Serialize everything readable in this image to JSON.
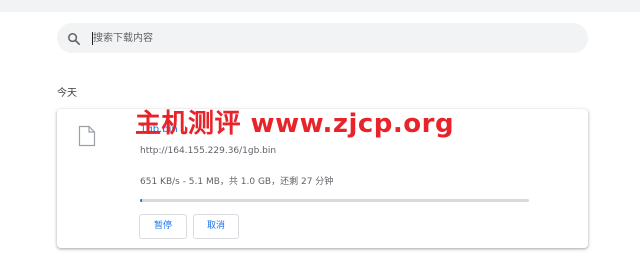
{
  "search": {
    "placeholder": "搜索下载内容",
    "icon": "search-icon"
  },
  "section": {
    "label": "今天"
  },
  "download": {
    "file_name": "1gb.bin",
    "url": "http://164.155.229.36/1gb.bin",
    "status": "651 KB/s - 5.1 MB，共 1.0 GB，还剩 27 分钟",
    "progress": 0.005,
    "file_icon": "file-icon",
    "pause_label": "暂停",
    "cancel_label": "取消"
  },
  "watermark": {
    "text": "主机测评 www.zjcp.org"
  },
  "colors": {
    "accent": "#1a73e8",
    "watermark": "#e8232a",
    "search_background": "#f1f3f4"
  }
}
